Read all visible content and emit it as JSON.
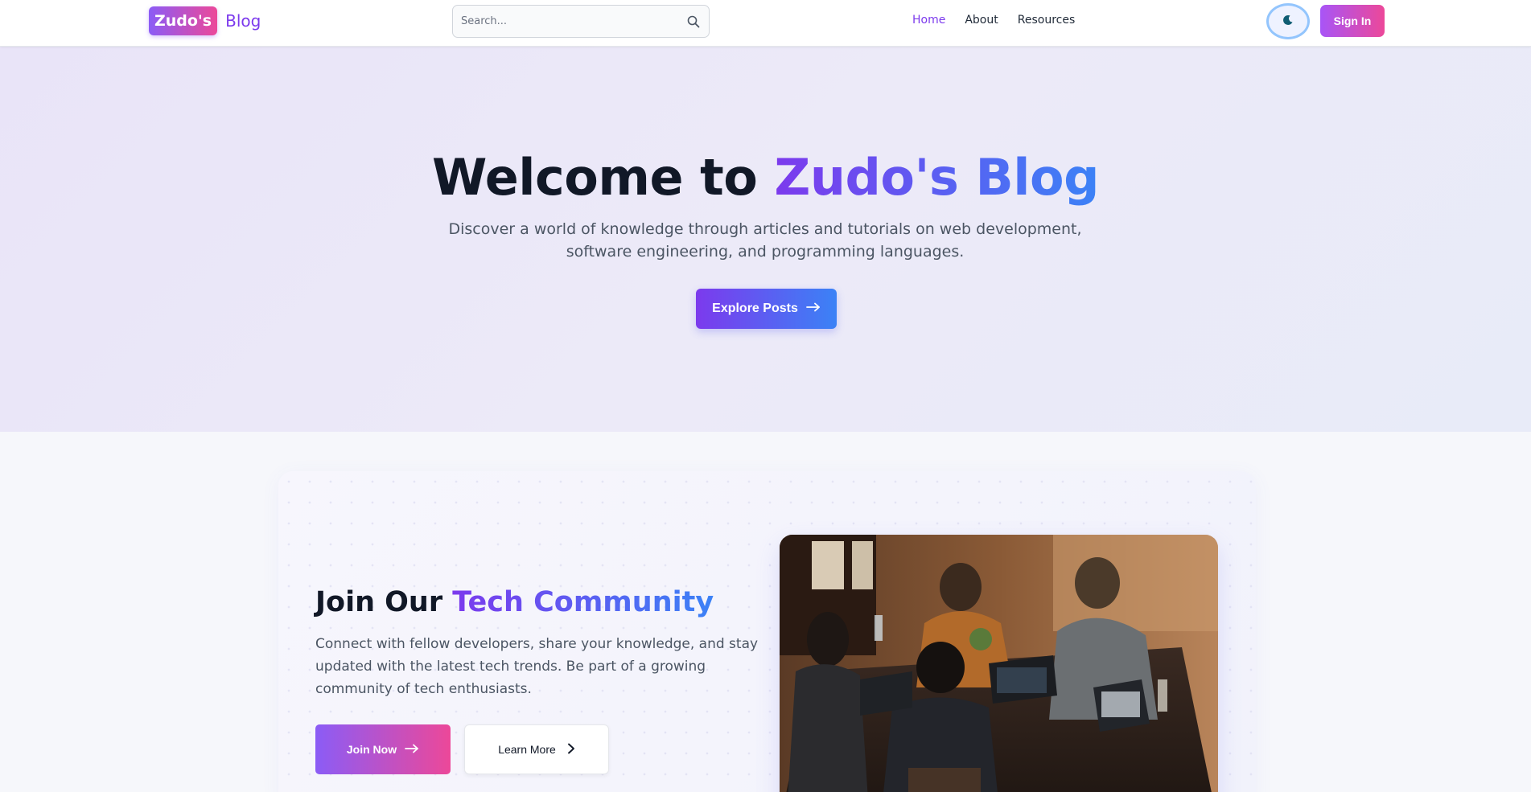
{
  "nav": {
    "logo_badge": "Zudo's",
    "logo_text": "Blog",
    "search_placeholder": "Search...",
    "links": [
      "Home",
      "About",
      "Resources"
    ],
    "active_link": "Home",
    "sign_in": "Sign In",
    "theme_icon": "moon-icon"
  },
  "hero": {
    "title_plain": "Welcome to ",
    "title_highlight": "Zudo's Blog",
    "subtitle": "Discover a world of knowledge through articles and tutorials on web development, software engineering, and programming languages.",
    "cta": "Explore Posts"
  },
  "community": {
    "title_plain": "Join Our ",
    "title_highlight": "Tech Community",
    "description": "Connect with fellow developers, share your knowledge, and stay updated with the latest tech trends. Be part of a growing community of tech enthusiasts.",
    "join_label": "Join Now",
    "learn_label": "Learn More"
  },
  "colors": {
    "accent_purple": "#7c3aed",
    "accent_blue": "#3b82f6",
    "accent_pink": "#ec4899"
  }
}
